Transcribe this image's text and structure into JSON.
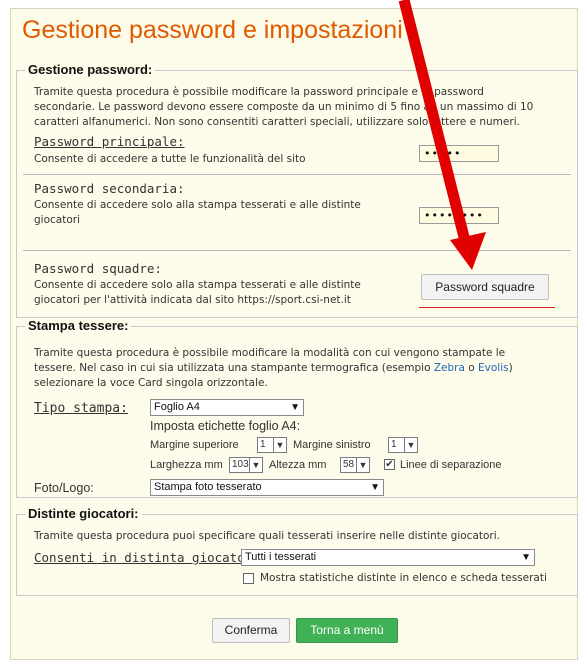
{
  "page": {
    "title": "Gestione password e impostazioni"
  },
  "password_section": {
    "legend": "Gestione password:",
    "intro": [
      "Tramite questa procedura è possibile modificare la password principale e le password",
      "secondarie. Le password devono essere composte da un minimo di 5 fino ad un massimo di 10",
      "caratteri alfanumerici. Non sono consentiti caratteri speciali, utilizzare solo lettere e numeri."
    ],
    "main": {
      "label": "Password principale:",
      "description": "Consente di accedere a tutte le funzionalità del sito",
      "value": "•••••"
    },
    "secondary": {
      "label": "Password secondaria:",
      "description": [
        "Consente di accedere solo alla stampa tesserati e alle distinte",
        "giocatori"
      ],
      "value": "••••••••"
    },
    "team": {
      "label": "Password squadre:",
      "description": [
        "Consente di accedere solo alla stampa tesserati e alle distinte",
        "giocatori per l'attività indicata dal sito https://sport.csi-net.it"
      ],
      "button_label": "Password squadre"
    }
  },
  "print_section": {
    "legend": "Stampa tessere:",
    "intro_1": "Tramite questa procedura è possibile modificare la modalità con cui vengono stampate le",
    "intro_2_before": "tessere. Nel caso in cui sia utilizzata una stampante termografica (esempio ",
    "intro_2_link1": "Zebra",
    "intro_2_mid": " o ",
    "intro_2_link2": "Evolis",
    "intro_2_after": ")",
    "intro_3": "selezionare la voce Card singola orizzontale.",
    "print_type": {
      "label": "Tipo stampa:",
      "selected": "Foglio A4"
    },
    "a4_labels": {
      "heading": "Imposta etichette foglio A4:",
      "top_margin_label": "Margine superiore",
      "top_margin_value": "1",
      "left_margin_label": "Margine sinistro",
      "left_margin_value": "1",
      "width_label": "Larghezza mm",
      "width_value": "103",
      "height_label": "Altezza mm",
      "height_value": "58",
      "separator_label": "Linee di separazione",
      "separator_checked": true
    },
    "photo_logo": {
      "label": "Foto/Logo:",
      "selected": "Stampa foto tesserato"
    }
  },
  "roster_section": {
    "legend": "Distinte giocatori:",
    "intro": "Tramite questa procedura puoi specificare quali tesserati inserire nelle distinte giocatori.",
    "allowed": {
      "label": "Consenti in distinta giocatori:",
      "selected": "Tutti i tesserati"
    },
    "stats_checkbox": {
      "label": "Mostra statistiche distinte in elenco e scheda tesserati",
      "checked": false
    }
  },
  "footer": {
    "confirm_label": "Conferma",
    "back_label": "Torna a menù"
  },
  "colors": {
    "title": "#e05a00",
    "annotation_arrow": "#e00000",
    "primary_button": "#41b155"
  }
}
